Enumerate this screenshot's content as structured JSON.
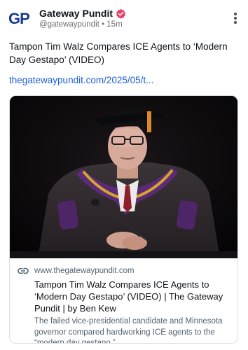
{
  "author": {
    "avatar_text": "GP",
    "display_name": "Gateway Pundit",
    "handle": "@gatewaypundit",
    "separator": "•",
    "time": "15m",
    "verified_color": "#e8436b"
  },
  "post": {
    "text": "Tampon Tim Walz Compares ICE Agents to ‘Modern Day Gestapo’ (VIDEO)",
    "link": "thegatewaypundit.com/2025/05/t..."
  },
  "link_card": {
    "domain": "www.thegatewaypundit.com",
    "title": "Tampon Tim Walz Compares ICE Agents to ‘Modern Day Gestapo’ (VIDEO) | The Gateway Pundit | by Ben Kew",
    "description": "The failed vice-presidential candidate and Minnesota governor compared hardworking ICE agents to the “modern day gestapo.”"
  },
  "colors": {
    "link": "#1d5fd6",
    "brand": "#1a3a8f"
  }
}
